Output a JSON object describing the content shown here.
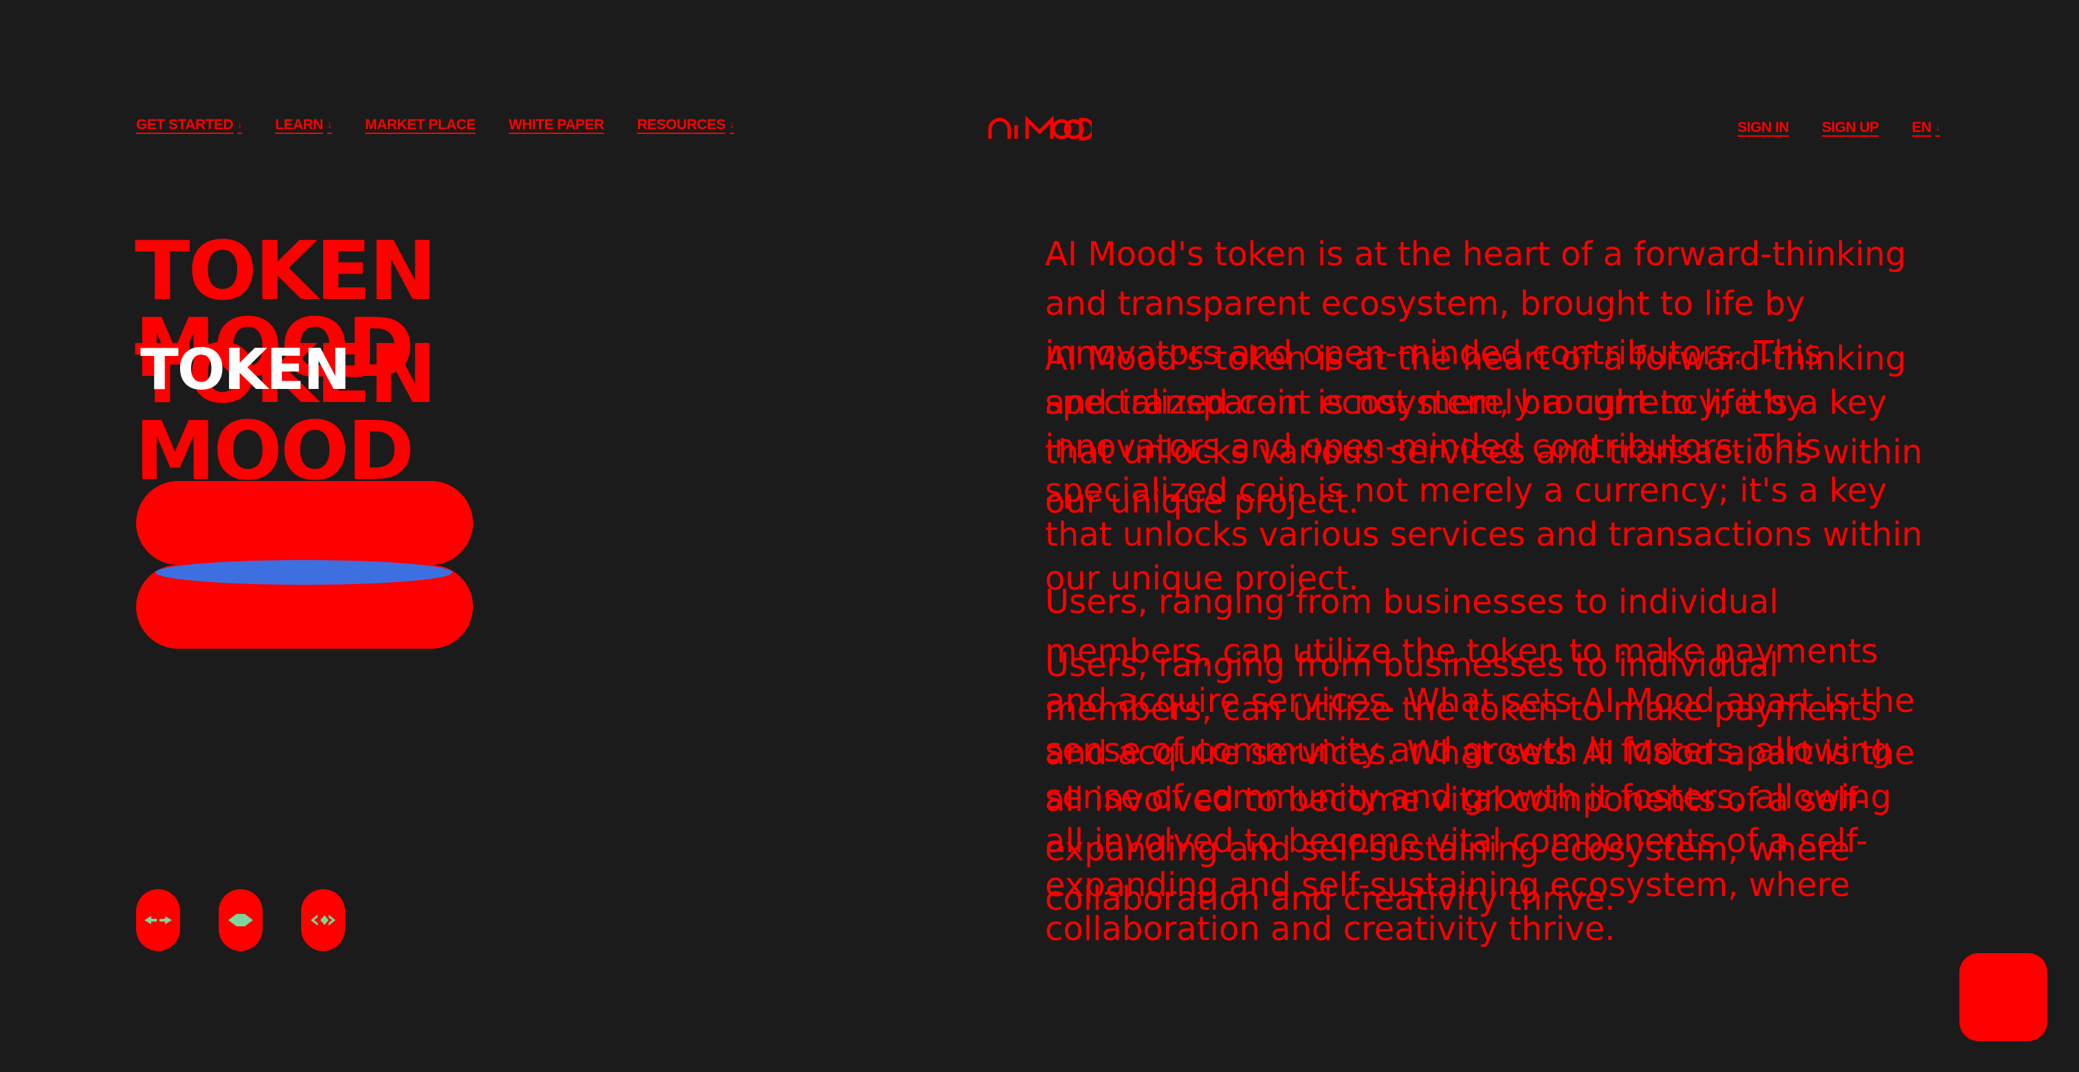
{
  "nav": {
    "left": [
      {
        "label": "GET STARTED",
        "caret": "↓"
      },
      {
        "label": "LEARN",
        "caret": "↓"
      },
      {
        "label": "MARKET PLACE",
        "caret": ""
      },
      {
        "label": "WHITE PAPER",
        "caret": ""
      },
      {
        "label": "RESOURCES",
        "caret": "↓"
      }
    ],
    "right": [
      {
        "label": "SIGN IN",
        "caret": ""
      },
      {
        "label": "SIGN UP",
        "caret": ""
      },
      {
        "label": "EN",
        "caret": "↓"
      }
    ]
  },
  "logo": {
    "text": "AI MOOD"
  },
  "hero": {
    "line1": "TOKEN",
    "line2": "MOOD",
    "ghost": "TOKEN"
  },
  "content": {
    "paragraph1": "AI Mood's token is at the heart of a forward-thinking and transparent ecosystem, brought to life by innovators and open-minded contributors. This specialized coin is not merely a currency; it's a key that unlocks various services and transactions within our unique project.",
    "paragraph2": "Users, ranging from businesses to individual members, can utilize the token to make payments and acquire services. What sets AI Mood apart is the sense of community and growth it fosters, allowing all involved to become vital components of a self-expanding and self-sustaining ecosystem, where collaboration and creativity thrive."
  },
  "icons": [
    "arrows-icon",
    "diamond-icon",
    "chevrons-icon"
  ],
  "colors": {
    "background": "#1b1b1b",
    "accent": "#ff0000",
    "icon_fill": "#7ed69a",
    "blue": "#3d6fe0"
  }
}
